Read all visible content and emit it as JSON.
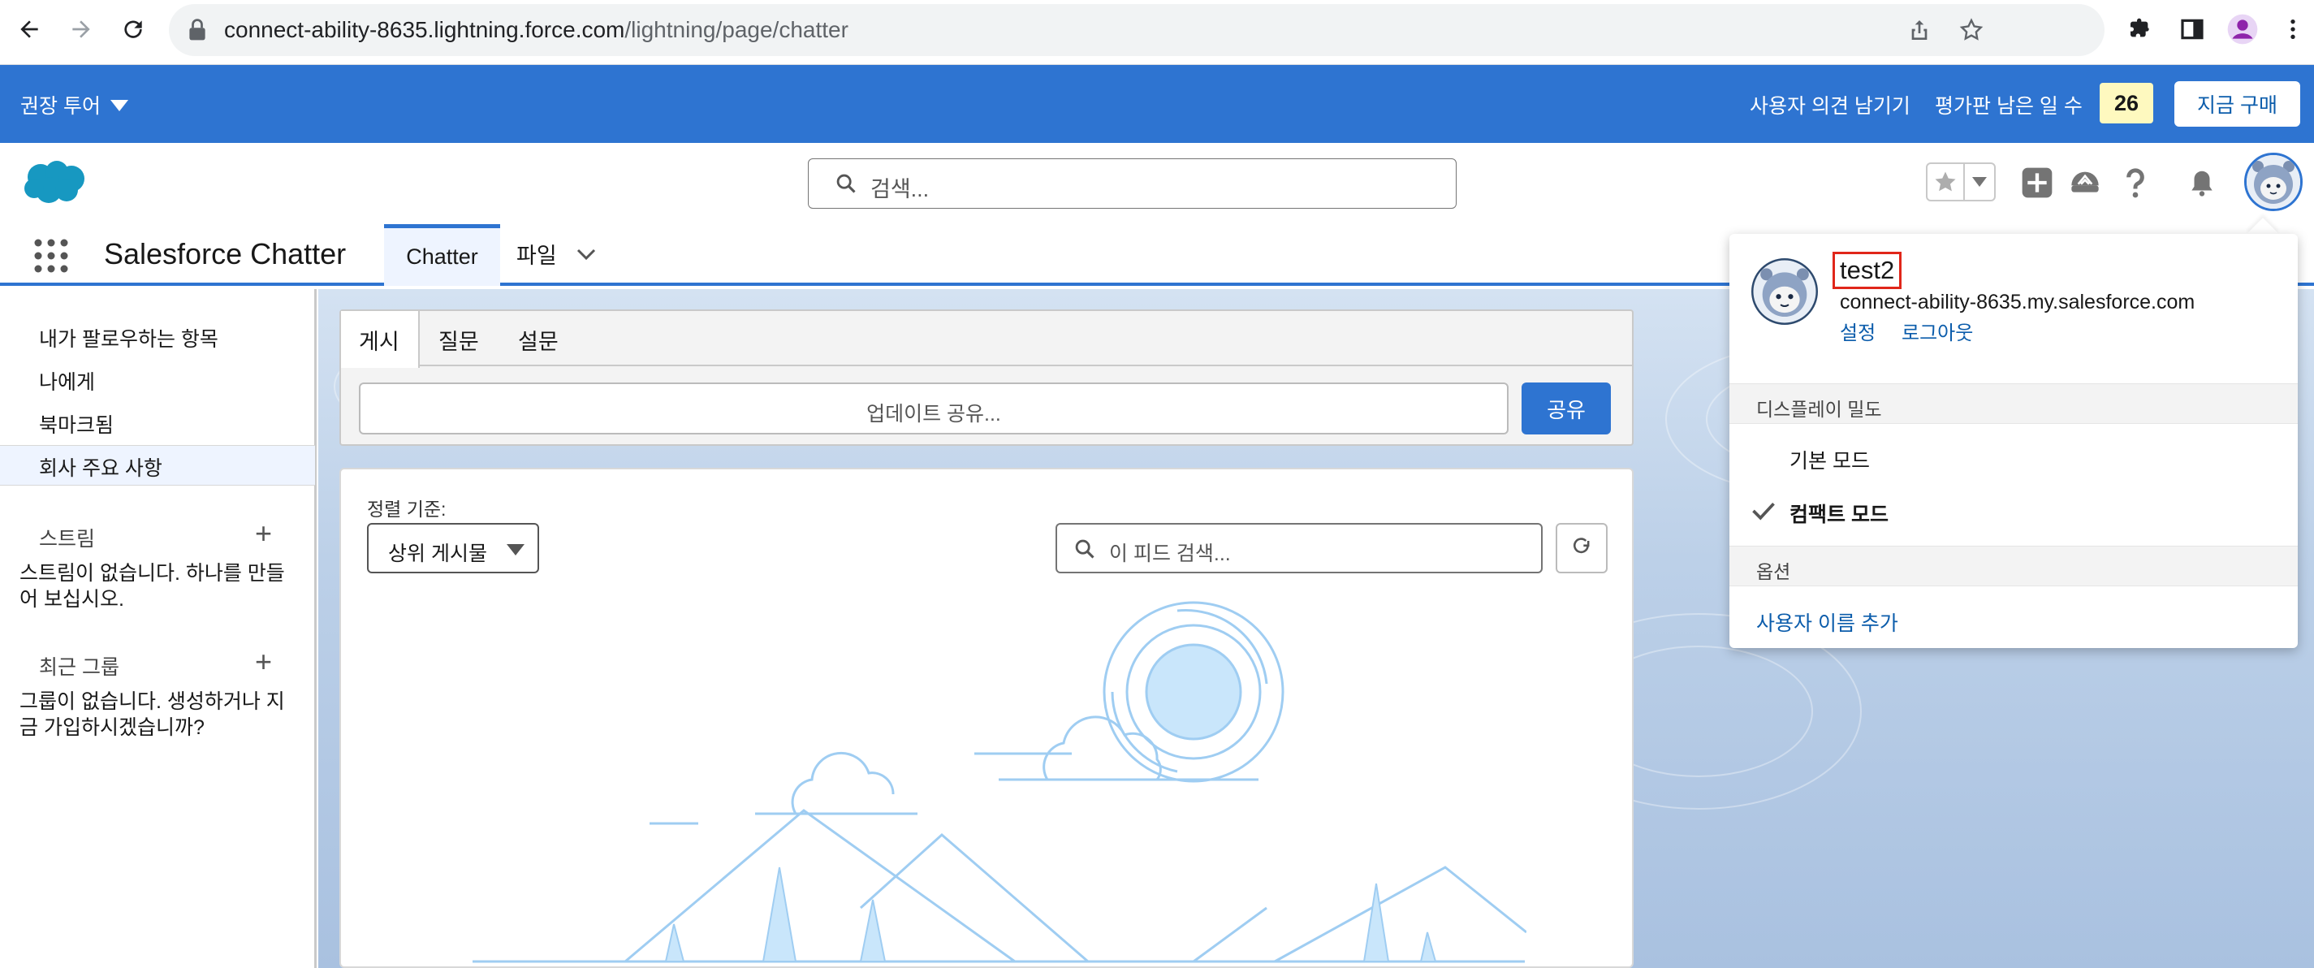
{
  "browser": {
    "url_host": "connect-ability-8635.lightning.force.com",
    "url_path": "/lightning/page/chatter",
    "icons": [
      "back-arrow-icon",
      "forward-arrow-icon",
      "reload-icon",
      "lock-icon",
      "share-icon",
      "bookmark-star-icon",
      "extensions-puzzle-icon",
      "side-panel-icon",
      "profile-icon",
      "kebab-menu-icon"
    ]
  },
  "trial_bar": {
    "tour_label": "권장 투어",
    "feedback_label": "사용자 의견 남기기",
    "days_left_label": "평가판 남은 일 수",
    "days_left_value": "26",
    "buy_label": "지금 구매"
  },
  "header": {
    "search_placeholder": "검색...",
    "icons": [
      "salesforce-cloud-logo",
      "favorites-star-icon",
      "global-actions-plus-icon",
      "trailhead-icon",
      "help-icon",
      "notifications-bell-icon",
      "user-avatar"
    ]
  },
  "app_nav": {
    "app_name": "Salesforce Chatter",
    "tabs": [
      {
        "label": "Chatter",
        "active": true
      },
      {
        "label": "파일",
        "active": false
      }
    ]
  },
  "sidebar": {
    "items": [
      {
        "label": "내가 팔로우하는 항목"
      },
      {
        "label": "나에게"
      },
      {
        "label": "북마크됨"
      },
      {
        "label": "회사 주요 사항",
        "active": true
      }
    ],
    "streams_heading": "스트림",
    "streams_empty": "스트림이 없습니다. 하나를 만들어 보십시오.",
    "groups_heading": "최근 그룹",
    "groups_empty": "그룹이 없습니다. 생성하거나 지금 가입하시겠습니까?"
  },
  "publisher": {
    "tabs": [
      "게시",
      "질문",
      "설문"
    ],
    "input_placeholder": "업데이트 공유...",
    "share_label": "공유"
  },
  "feed": {
    "sort_label": "정렬 기준:",
    "sort_value": "상위 게시물",
    "search_placeholder": "이 피드 검색..."
  },
  "profile_menu": {
    "username": "test2",
    "domain": "connect-ability-8635.my.salesforce.com",
    "settings_label": "설정",
    "logout_label": "로그아웃",
    "density_heading": "디스플레이 밀도",
    "density_options": [
      {
        "label": "기본 모드",
        "selected": false
      },
      {
        "label": "컴팩트 모드",
        "selected": true
      }
    ],
    "options_heading": "옵션",
    "add_username_label": "사용자 이름 추가"
  },
  "colors": {
    "brand_blue": "#2e74d1",
    "link_blue": "#0b5cab",
    "badge_yellow": "#fef9bf",
    "highlight_red": "#e0261a"
  }
}
